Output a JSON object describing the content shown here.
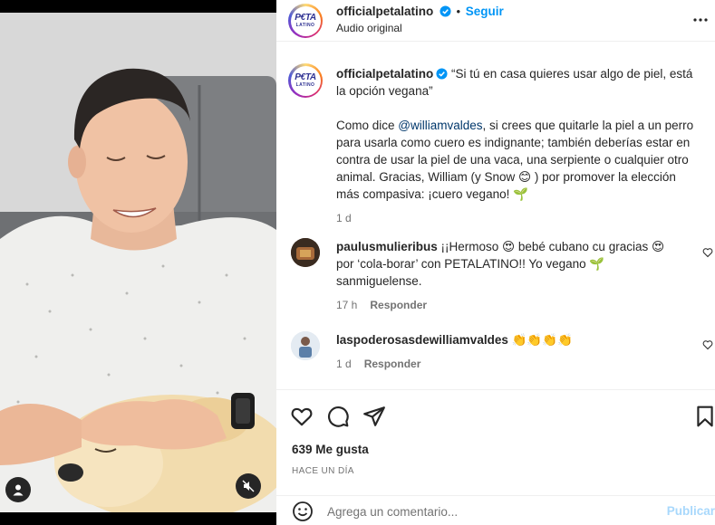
{
  "post": {
    "author": "officialpetalatino",
    "follow_label": "Seguir",
    "audio_label": "Audio original",
    "logo_text_top": "P€TA",
    "logo_text_bottom": "LATINO"
  },
  "caption": {
    "username": "officialpetalatino",
    "line1": " “Si tú en casa quieres usar algo de piel, está la opción vegana”",
    "para_pre": "Como dice ",
    "mention": "@williamvaldes",
    "para_post": ", si crees que quitarle la piel a un perro para usarla como cuero es indignante; también deberías estar en contra de usar la piel de una vaca, una serpiente o cualquier otro animal. Gracias, William (y Snow 😊 ) por promover la elección más compasiva: ¡cuero vegano! 🌱",
    "time": "1 d"
  },
  "comments": [
    {
      "username": "paulusmulieribus",
      "text": " ¡¡Hermoso 😍 bebé cubano cu gracias 😍 por ‘cola-borar’ con PETALATINO!! Yo vegano 🌱 sanmiguelense.",
      "time": "17 h",
      "reply_label": "Responder"
    },
    {
      "username": "laspoderosasdewilliamvaldes",
      "text": " 👏👏👏👏",
      "time": "1 d",
      "reply_label": "Responder"
    }
  ],
  "engagement": {
    "likes": "639 Me gusta",
    "posted": "HACE UN DÍA"
  },
  "composer": {
    "placeholder": "Agrega un comentario...",
    "publish_label": "Publicar"
  },
  "colors": {
    "accent": "#0095f6",
    "publish_disabled": "#a8d8fc",
    "muted_text": "#737373",
    "mention": "#00376b"
  },
  "icons": [
    "verified-badge-icon",
    "more-options-icon",
    "heart-icon",
    "comment-icon",
    "share-icon",
    "bookmark-icon",
    "emoji-icon",
    "user-tag-icon",
    "muted-audio-icon"
  ]
}
